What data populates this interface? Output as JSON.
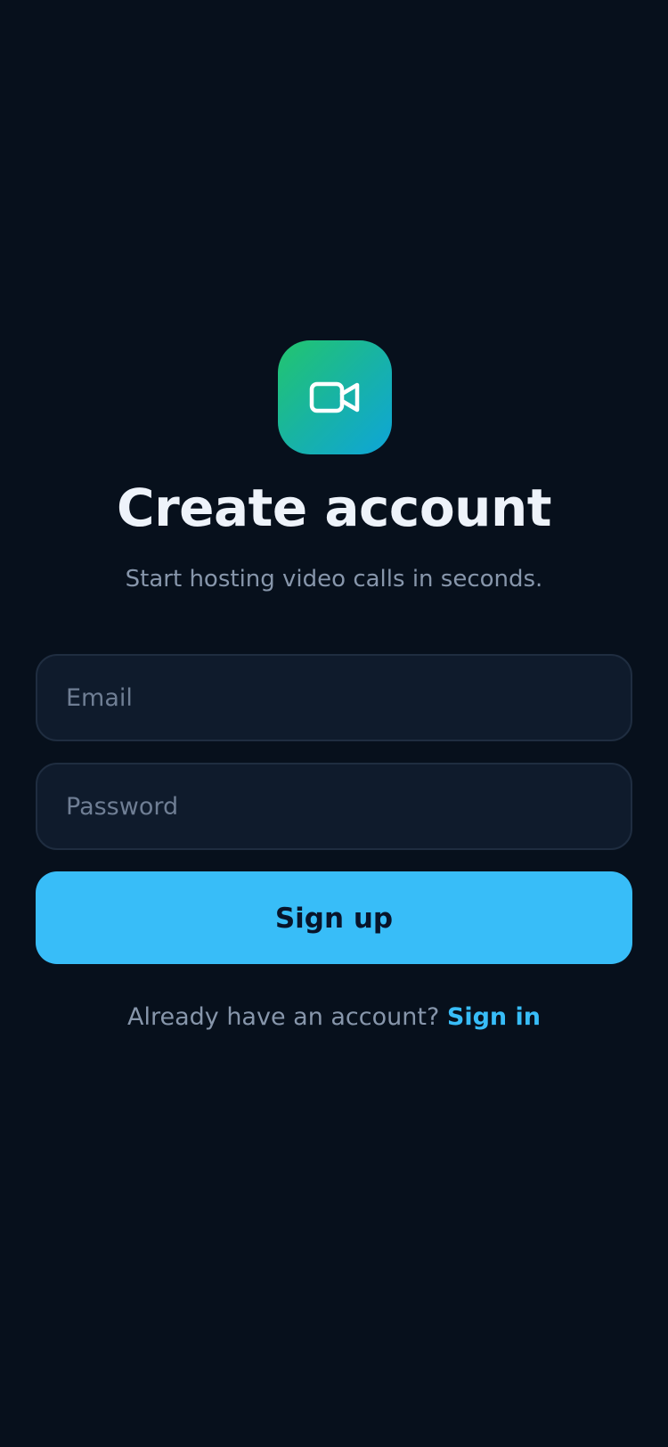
{
  "logo": {
    "icon": "video-camera-icon",
    "gradient_start": "#22c56e",
    "gradient_end": "#0ea5d8"
  },
  "header": {
    "title": "Create account",
    "subtitle": "Start hosting video calls in seconds."
  },
  "form": {
    "email": {
      "value": "",
      "placeholder": "Email"
    },
    "password": {
      "value": "",
      "placeholder": "Password"
    },
    "submit_label": "Sign up"
  },
  "footer": {
    "prompt": "Already have an account?",
    "link_label": "Sign in"
  },
  "colors": {
    "background": "#07101c",
    "accent": "#38bdf8",
    "field_background": "#0f1b2c"
  }
}
